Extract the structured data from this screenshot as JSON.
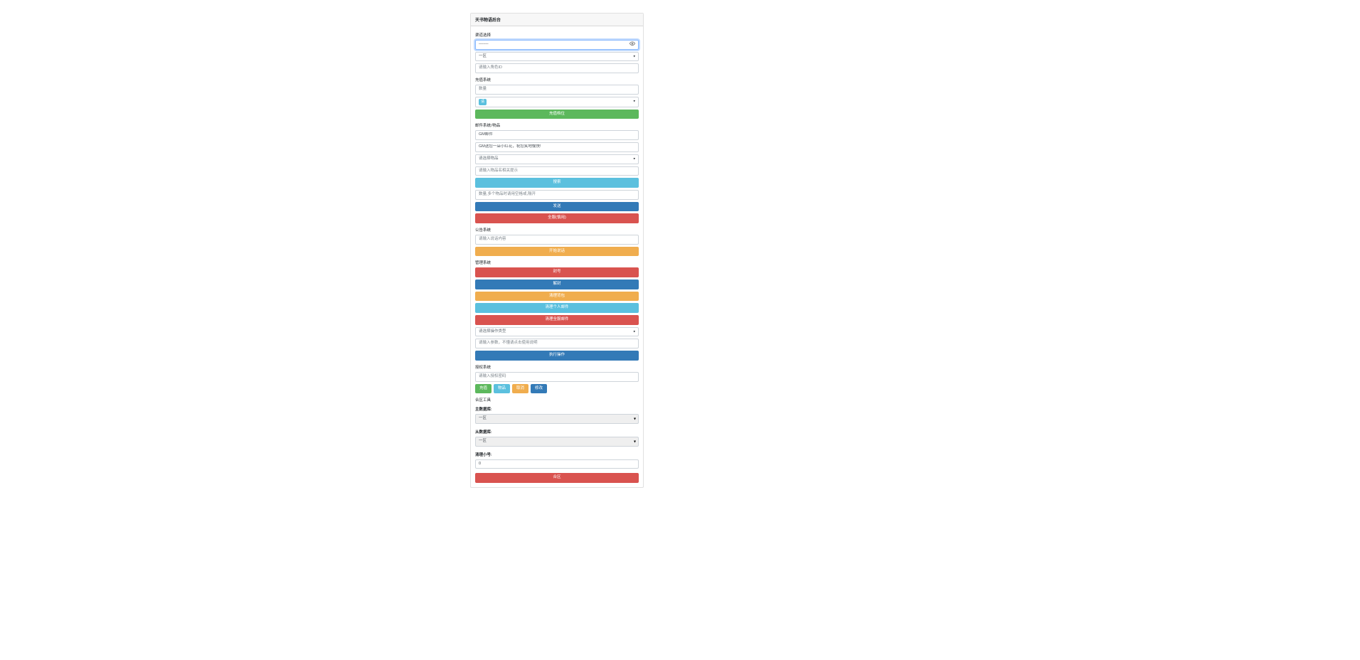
{
  "title": "天书物语后台",
  "channel": {
    "label": "渠道选择",
    "value": "---------"
  },
  "zone": {
    "value": "一区"
  },
  "role": {
    "placeholder": "请输入角色ID"
  },
  "recharge": {
    "label": "充值系统",
    "amount_placeholder": "数量",
    "select_tag": "请",
    "button": "充值档位"
  },
  "mail": {
    "label": "邮件系统/物品",
    "title_value": "GM邮件",
    "body_value": "GM送您一朵小红花，祝您笑地愉快!",
    "item_select_placeholder": "请选择物品",
    "search_input_placeholder": "请输入物品名相关提示",
    "search_button": "搜索",
    "amount_placeholder": "数量,多个物品时请用空格或,隔开",
    "send_button": "发送",
    "allserver_button": "全服(慎用)"
  },
  "announce": {
    "label": "公告系统",
    "placeholder": "请输入说话内容",
    "button": "开始说话"
  },
  "manage": {
    "label": "管理系统",
    "ban_button": "封号",
    "unban_button": "解封",
    "clear_bag_button": "清理背包",
    "clear_personal_mail_button": "清理个人邮件",
    "clear_all_mail_button": "清理全服邮件",
    "op_select_placeholder": "请选择操作类型",
    "param_placeholder": "请输入参数，不懂请点击使用说明",
    "execute_button": "执行操作"
  },
  "auth": {
    "label": "授权系统",
    "placeholder": "请输入授权密码",
    "buttons": {
      "recharge": "充值",
      "item": "物品",
      "cancel": "取消",
      "modify": "修改"
    }
  },
  "merge": {
    "label": "合区工具",
    "main_db_label": "主数据库:",
    "main_db_value": "一区",
    "sub_db_label": "从数据库:",
    "sub_db_value": "一区",
    "clear_label": "清理小号:",
    "clear_value": "0",
    "button": "合区"
  }
}
